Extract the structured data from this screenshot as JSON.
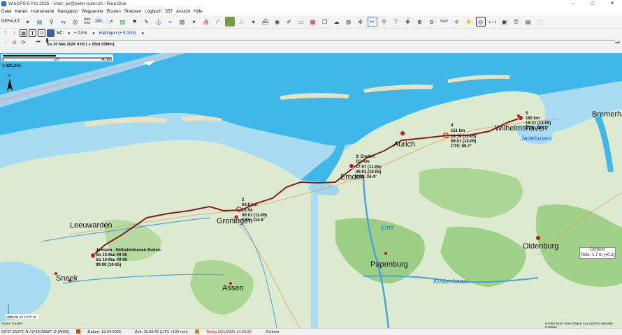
{
  "window": {
    "title": "WinGPS 6 Pro 2025 - User: ps@peter-suter.ch - Rina Blue",
    "minimize": "–",
    "maximize": "□",
    "close": "✕"
  },
  "menu": [
    "Datei",
    "Karten",
    "Instrumente",
    "Navigation",
    "Wegpunkte",
    "Routen",
    "Strecken",
    "Logbuch",
    "S57",
    "Ansicht",
    "Hilfe"
  ],
  "toolbar": {
    "profile": "DEFAULT",
    "start_label": "start",
    "start_sub": "stop",
    "xpl_label": "XPL",
    "nav_label": "NAV"
  },
  "toolbar2": {
    "depth": "+ 0.0m",
    "tide_station": "Harlingen (+ 0.00m)"
  },
  "timebar": {
    "datetime": "So 10 Mai 2026 9:00  ( + 05td 00Min)"
  },
  "map": {
    "scale_ticks": [
      "0",
      "20",
      "40 km"
    ],
    "zoom_ratio": "1:426,205",
    "north": "N",
    "cities": [
      {
        "name": "Leeuwarden"
      },
      {
        "name": "Groningen"
      },
      {
        "name": "Emden"
      },
      {
        "name": "Aurich"
      },
      {
        "name": "Wilhelmshaven"
      },
      {
        "name": "Bremerha"
      },
      {
        "name": "Oldenburg"
      },
      {
        "name": "Papenburg"
      },
      {
        "name": "Sneek"
      },
      {
        "name": "Assen"
      }
    ],
    "water_labels": [
      {
        "name": "Jadebusen"
      },
      {
        "name": "Ems"
      },
      {
        "name": "Küstenkanal"
      }
    ],
    "waypoints": [
      {
        "lines": [
          "Jirnsum - Wilhelmshaven Buiten",
          "So 10-Mai 09:00",
          "So 10-Mai 09:00",
          "09:00 (10-05)"
        ]
      },
      {
        "lines": [
          "2",
          "63.8 km",
          "15:54",
          "09:01 (11-05)",
          "CTS: 114.5°"
        ]
      },
      {
        "lines": [
          "3: Emden",
          "111 km",
          "17:57 (11-05)",
          "09:01 (12-05)",
          "CTS: 34.4°"
        ]
      },
      {
        "lines": [
          "4",
          "151 km",
          "16:19 (12-05)",
          "09:01 (13-05)",
          "CTS: 89.7°"
        ]
      },
      {
        "lines": [
          "5",
          "180 km",
          "15:31 (13-05)",
          "CTS: 357.3°"
        ]
      }
    ],
    "tooltip": {
      "title": "Ochtum",
      "subtitle": "Tiefe: 1.7 m (+0.2)"
    },
    "track_note": "2025-04-14 11:37:19",
    "active_tracker": "Aktive Tracker",
    "corner_note": "Karten-Nord oben folgen  Aus (100%)  Aktuelle Position"
  },
  "status": {
    "position": "53°07.21972' N / 8°39.05687' O (WGE)",
    "date": "Datum: 19.04.2025",
    "time": "Zeit: 15:56:42 (UTC +120 min)",
    "tidelog": "Tiefdg 3/21/2025 14:20:28",
    "place": "Ochtum"
  },
  "colors": {
    "route": "#8a1d1d",
    "sea": "#3fb7e8",
    "land": "#dcead0",
    "shallow": "#a9dcf0",
    "waypoint": "#d21a1a"
  }
}
